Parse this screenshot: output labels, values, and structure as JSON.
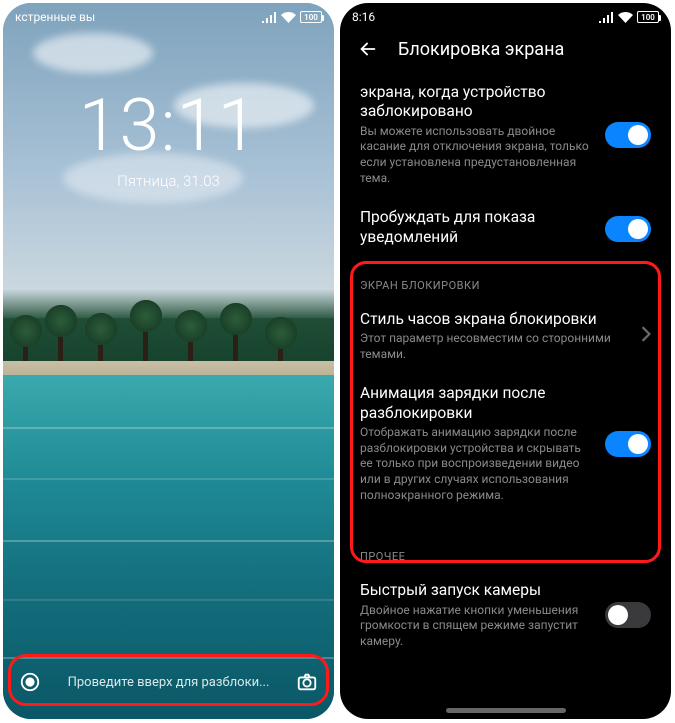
{
  "left": {
    "status_left": "кстренные вы",
    "battery": "100",
    "clock": "13:11",
    "date": "Пятница, 31.03",
    "swipe_hint": "Проведите вверх для разблоки..."
  },
  "right": {
    "status_time": "8:16",
    "battery": "100",
    "header_title": "Блокировка экрана",
    "item_partial_title": "экрана, когда устройство заблокировано",
    "item_partial_desc": "Вы можете использовать двойное касание для отключения экрана, только если установлена предустановленная тема.",
    "item_wake_title": "Пробуждать для показа уведомлений",
    "section_lock": "ЭКРАН БЛОКИРОВКИ",
    "item_clockstyle_title": "Стиль часов экрана блокировки",
    "item_clockstyle_desc": "Этот параметр несовместим со сторонними темами.",
    "item_anim_title": "Анимация зарядки после разблокировки",
    "item_anim_desc": "Отображать анимацию зарядки после разблокировки устройства и скрывать ее только при воспроизведении видео или в других случаях использования полноэкранного режима.",
    "section_other": "ПРОЧЕЕ",
    "item_camera_title": "Быстрый запуск камеры",
    "item_camera_desc": "Двойное нажатие кнопки уменьшения громкости в спящем режиме запустит камеру."
  }
}
